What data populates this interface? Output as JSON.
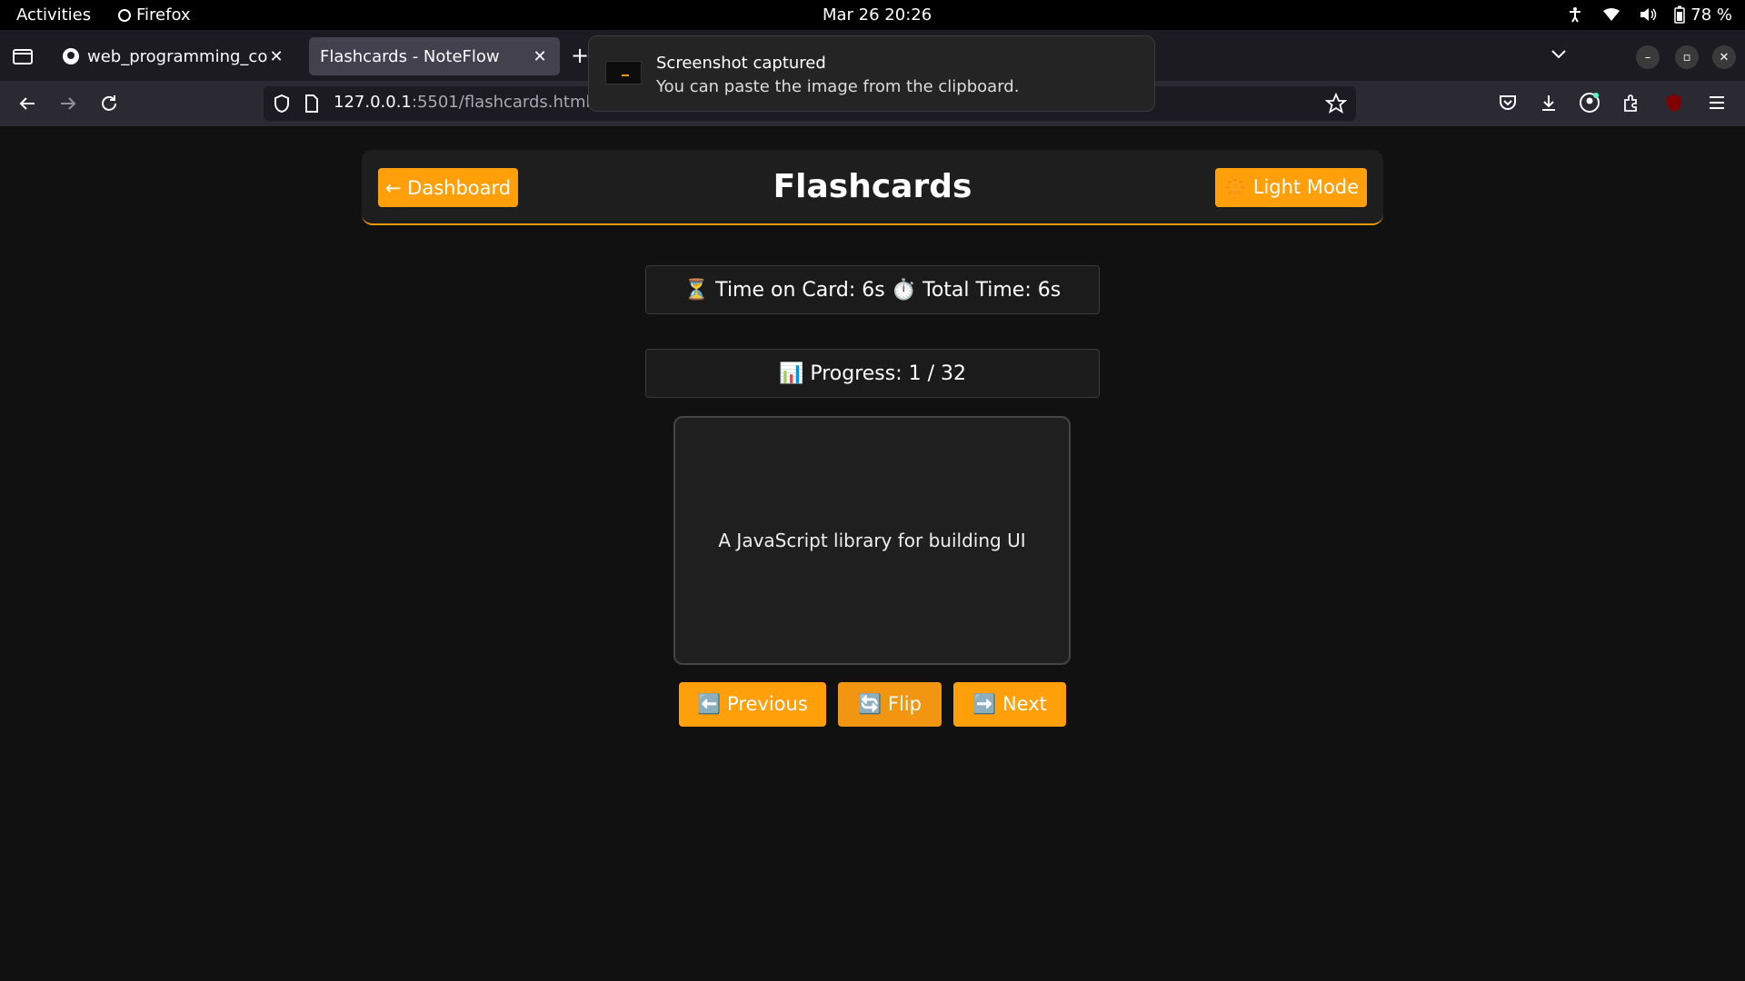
{
  "system": {
    "activities": "Activities",
    "app": "Firefox",
    "clock": "Mar 26  20:26",
    "battery": "78 %"
  },
  "browser": {
    "tabs": [
      {
        "label": "web_programming_code"
      },
      {
        "label": "Flashcards - NoteFlow"
      }
    ],
    "url_host": "127.0.0.1",
    "url_rest": ":5501/flashcards.html"
  },
  "notification": {
    "title": "Screenshot captured",
    "body": "You can paste the image from the clipboard."
  },
  "page": {
    "title": "Flashcards",
    "dashboard_button": "← Dashboard",
    "light_mode_button": "🔆 Light Mode",
    "timer_text": "⏳ Time on Card: 6s ⏱️ Total Time: 6s",
    "progress_text": "📊 Progress: 1 / 32",
    "card_text": "A JavaScript library for building UI",
    "prev_button": "⬅️ Previous",
    "flip_button": "🔄 Flip",
    "next_button": "➡️ Next"
  },
  "colors": {
    "accent": "#ff9f0a",
    "background": "#111111",
    "panel": "#1e1e1e"
  }
}
